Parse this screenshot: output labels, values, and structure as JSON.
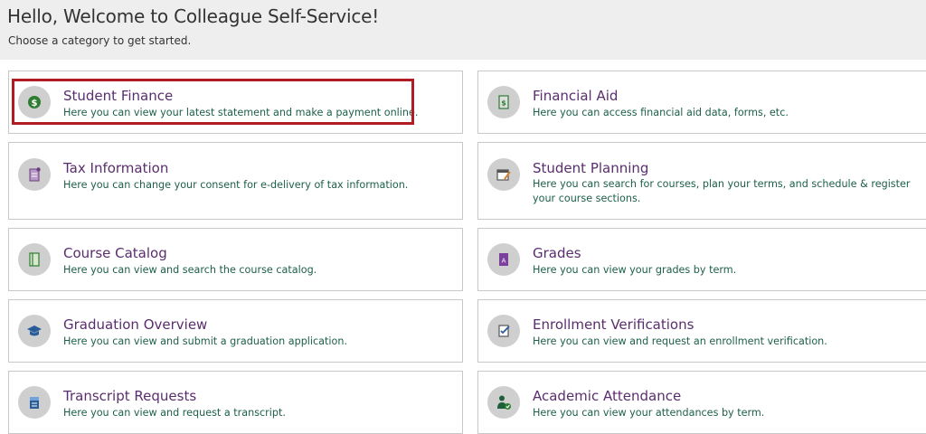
{
  "header": {
    "title": "Hello, Welcome to Colleague Self-Service!",
    "subtitle": "Choose a category to get started."
  },
  "tiles": [
    {
      "title": "Student Finance",
      "description": "Here you can view your latest statement and make a payment online."
    },
    {
      "title": "Financial Aid",
      "description": "Here you can access financial aid data, forms, etc."
    },
    {
      "title": "Tax Information",
      "description": "Here you can change your consent for e-delivery of tax information."
    },
    {
      "title": "Student Planning",
      "description": "Here you can search for courses, plan your terms, and schedule & register your course sections."
    },
    {
      "title": "Course Catalog",
      "description": "Here you can view and search the course catalog."
    },
    {
      "title": "Grades",
      "description": "Here you can view your grades by term."
    },
    {
      "title": "Graduation Overview",
      "description": "Here you can view and submit a graduation application."
    },
    {
      "title": "Enrollment Verifications",
      "description": "Here you can view and request an enrollment verification."
    },
    {
      "title": "Transcript Requests",
      "description": "Here you can view and request a transcript."
    },
    {
      "title": "Academic Attendance",
      "description": "Here you can view your attendances by term."
    }
  ],
  "icons": {
    "student_finance": "dollar-coin-icon",
    "financial_aid": "money-document-icon",
    "tax_information": "tax-document-icon",
    "student_planning": "calendar-planning-icon",
    "course_catalog": "catalog-book-icon",
    "grades": "grade-report-icon",
    "graduation_overview": "graduation-cap-icon",
    "enrollment_verifications": "verification-checklist-icon",
    "transcript_requests": "transcript-icon",
    "academic_attendance": "person-check-icon"
  },
  "colors": {
    "title": "#5a2d6e",
    "description": "#1c5f4a",
    "highlight": "#b01c22",
    "header_bg": "#eeeeee"
  }
}
